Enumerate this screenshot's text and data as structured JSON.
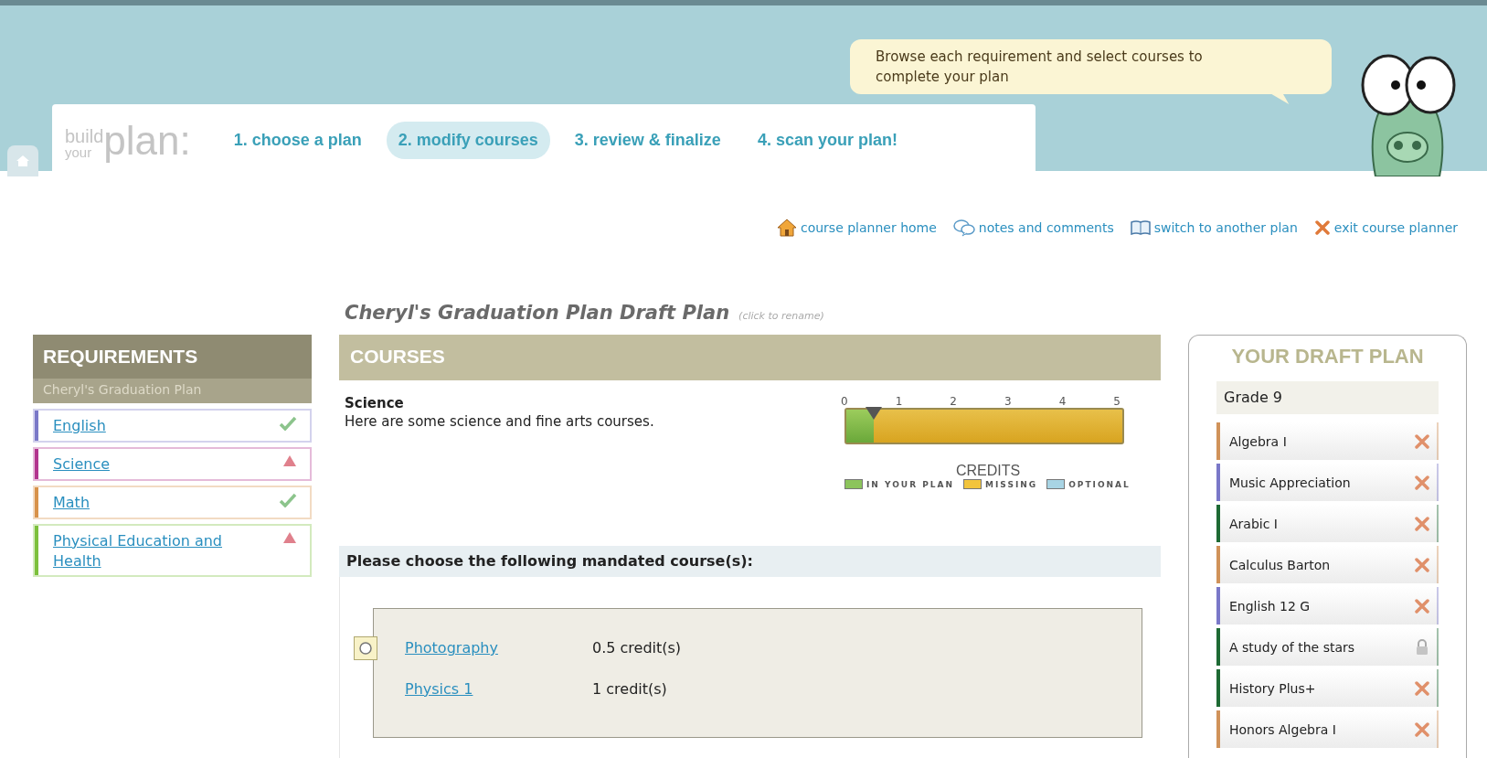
{
  "header": {
    "bubble": "Browse each requirement and select courses to complete your plan",
    "logo": {
      "line1": "build",
      "line2": "your",
      "big": "plan:"
    },
    "steps": [
      {
        "label": "1. choose a plan",
        "selected": false
      },
      {
        "label": "2. modify courses",
        "selected": true
      },
      {
        "label": "3. review & finalize",
        "selected": false
      },
      {
        "label": "4. scan your plan!",
        "selected": false
      }
    ]
  },
  "links": [
    {
      "kind": "home",
      "label": "course planner home"
    },
    {
      "kind": "notes",
      "label": "notes and comments"
    },
    {
      "kind": "switch",
      "label": "switch to another plan"
    },
    {
      "kind": "exit",
      "label": "exit course planner"
    }
  ],
  "plan_title": {
    "name": "Cheryl's Graduation Plan Draft Plan",
    "hint": "(click to rename)"
  },
  "requirements": {
    "title": "REQUIREMENTS",
    "subtitle": "Cheryl's Graduation Plan",
    "items": [
      {
        "label": "English",
        "kind": "done",
        "color": "#7a78c8"
      },
      {
        "label": "Science",
        "kind": "missing",
        "color": "#b2348e"
      },
      {
        "label": "Math",
        "kind": "done",
        "color": "#d8924a"
      },
      {
        "label": "Physical Education and Health",
        "kind": "missing",
        "color": "#7cc03c"
      }
    ]
  },
  "courses": {
    "title": "COURSES",
    "subject": "Science",
    "description": "Here are some science and fine arts courses.",
    "meter": {
      "ticks": [
        "0",
        "1",
        "2",
        "3",
        "4",
        "5"
      ],
      "level": 0.1,
      "caption": "CREDITS",
      "legend": [
        {
          "label": "IN YOUR PLAN",
          "color": "#8cc45c"
        },
        {
          "label": "MISSING",
          "color": "#f2c43c"
        },
        {
          "label": "OPTIONAL",
          "color": "#a8d4e4"
        }
      ]
    },
    "mandated": "Please choose the following mandated course(s):",
    "options": [
      {
        "name": "Photography",
        "credits": "0.5 credit(s)",
        "kind": "radio",
        "selected": false
      },
      {
        "name": "Physics 1",
        "credits": "1 credit(s)",
        "kind": "plain"
      }
    ]
  },
  "draft": {
    "title": "YOUR DRAFT PLAN",
    "grade": "Grade 9",
    "items": [
      {
        "name": "Algebra I",
        "kind": "removable",
        "color": "#d0925a"
      },
      {
        "name": "Music Appreciation",
        "kind": "removable",
        "color": "#7a78c8"
      },
      {
        "name": "Arabic I",
        "kind": "removable",
        "color": "#1e6a34"
      },
      {
        "name": "Calculus Barton",
        "kind": "removable",
        "color": "#d0925a"
      },
      {
        "name": "English 12 G",
        "kind": "removable",
        "color": "#7a78c8"
      },
      {
        "name": "A study of the stars",
        "kind": "locked",
        "color": "#1e6a34"
      },
      {
        "name": "History Plus+",
        "kind": "removable",
        "color": "#1e6a34"
      },
      {
        "name": "Honors Algebra I",
        "kind": "removable",
        "color": "#d0925a"
      }
    ]
  }
}
